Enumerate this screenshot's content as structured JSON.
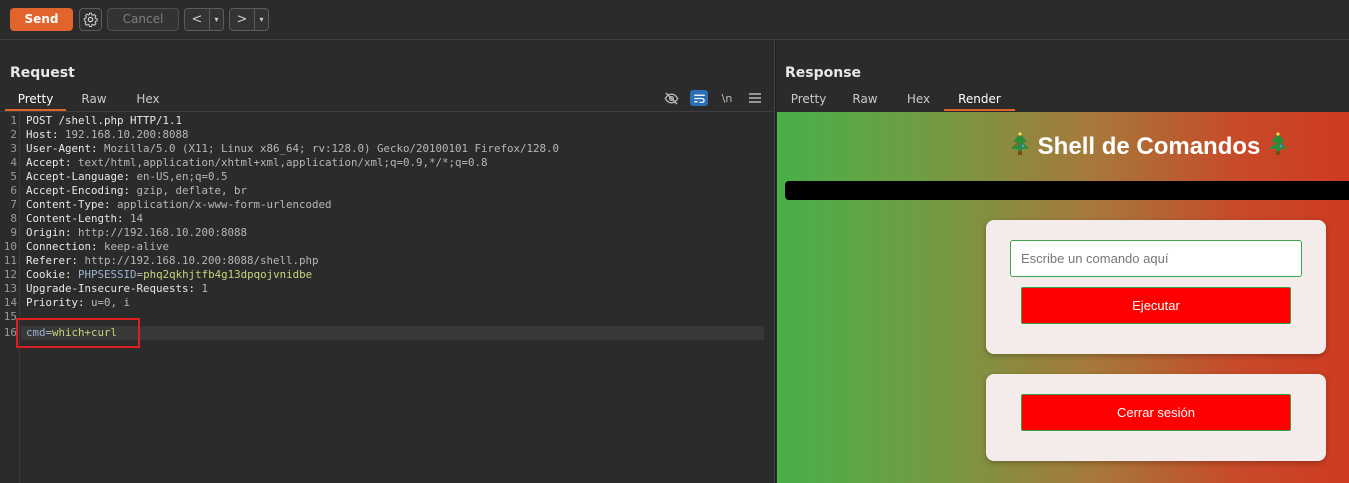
{
  "toolbar": {
    "send_label": "Send",
    "cancel_label": "Cancel",
    "prev_label": "<",
    "next_label": ">",
    "dropdown_glyph": "▾"
  },
  "request": {
    "title": "Request",
    "tabs": [
      {
        "label": "Pretty",
        "active": true
      },
      {
        "label": "Raw",
        "active": false
      },
      {
        "label": "Hex",
        "active": false
      }
    ],
    "newline_toggle": "\\n",
    "lines": [
      {
        "n": "1",
        "key": "POST /shell.php HTTP/1.1",
        "val": ""
      },
      {
        "n": "2",
        "key": "Host:",
        "val": " 192.168.10.200:8088"
      },
      {
        "n": "3",
        "key": "User-Agent:",
        "val": " Mozilla/5.0 (X11; Linux x86_64; rv:128.0) Gecko/20100101 Firefox/128.0"
      },
      {
        "n": "4",
        "key": "Accept:",
        "val": " text/html,application/xhtml+xml,application/xml;q=0.9,*/*;q=0.8"
      },
      {
        "n": "5",
        "key": "Accept-Language:",
        "val": " en-US,en;q=0.5"
      },
      {
        "n": "6",
        "key": "Accept-Encoding:",
        "val": " gzip, deflate, br"
      },
      {
        "n": "7",
        "key": "Content-Type:",
        "val": " application/x-www-form-urlencoded"
      },
      {
        "n": "8",
        "key": "Content-Length:",
        "val": " 14"
      },
      {
        "n": "9",
        "key": "Origin:",
        "val": " http://192.168.10.200:8088"
      },
      {
        "n": "10",
        "key": "Connection:",
        "val": " keep-alive"
      },
      {
        "n": "11",
        "key": "Referer:",
        "val": " http://192.168.10.200:8088/shell.php"
      },
      {
        "n": "12",
        "key": "Cookie:",
        "val": ""
      },
      {
        "n": "13",
        "key": "Upgrade-Insecure-Requests:",
        "val": " 1"
      },
      {
        "n": "14",
        "key": "Priority:",
        "val": " u=0, i"
      },
      {
        "n": "15",
        "key": "",
        "val": ""
      },
      {
        "n": "16",
        "key": "",
        "val": ""
      }
    ],
    "cookie": {
      "name": "PHPSESSID",
      "eq": "=",
      "value": "phq2qkhjtfb4g13dpqojvnidbe"
    },
    "body": {
      "param": "cmd",
      "eq": "=",
      "value": "which+curl"
    }
  },
  "response": {
    "title": "Response",
    "tabs": [
      {
        "label": "Pretty",
        "active": false
      },
      {
        "label": "Raw",
        "active": false
      },
      {
        "label": "Hex",
        "active": false
      },
      {
        "label": "Render",
        "active": true
      }
    ],
    "render": {
      "heading": "Shell de Comandos",
      "input_placeholder": "Escribe un comando aquí",
      "execute_label": "Ejecutar",
      "logout_label": "Cerrar sesión"
    }
  },
  "colors": {
    "accent": "#e0642b",
    "render_gradient_start": "#47b049",
    "render_gradient_end": "#cf3a21",
    "button_red": "#ff0000",
    "highlight_box": "#e02020"
  }
}
